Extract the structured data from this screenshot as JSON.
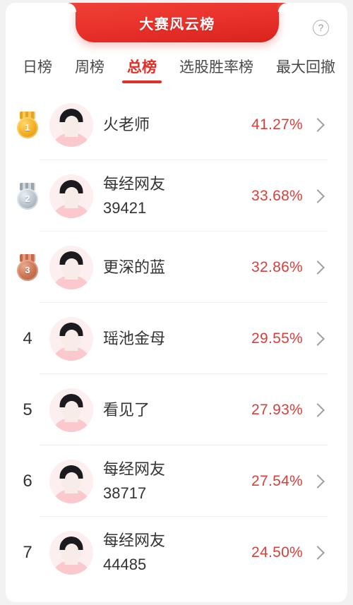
{
  "header": {
    "banner_title": "大赛风云榜",
    "help_label": "?",
    "help_icon": "question-mark-circle-icon"
  },
  "tabs": [
    {
      "label": "日榜",
      "active": false
    },
    {
      "label": "周榜",
      "active": false
    },
    {
      "label": "总榜",
      "active": true
    },
    {
      "label": "选股胜率榜",
      "active": false
    },
    {
      "label": "最大回撤",
      "active": false
    }
  ],
  "colors": {
    "brand_red": "#e8302a",
    "accent_red": "#e03027",
    "value_red": "#d6413b",
    "text_dark": "#333333",
    "divider": "#f0f0f0",
    "avatar_bg": "#fdeff0"
  },
  "leaderboard": [
    {
      "rank": "1",
      "medal": "gold",
      "name_line1": "火老师",
      "name_line2": "",
      "percent": "41.27%",
      "chevron": "chevron-right-icon"
    },
    {
      "rank": "2",
      "medal": "silver",
      "name_line1": "每经网友",
      "name_line2": "39421",
      "percent": "33.68%",
      "chevron": "chevron-right-icon"
    },
    {
      "rank": "3",
      "medal": "bronze",
      "name_line1": "更深的蓝",
      "name_line2": "",
      "percent": "32.86%",
      "chevron": "chevron-right-icon"
    },
    {
      "rank": "4",
      "medal": "",
      "name_line1": "瑶池金母",
      "name_line2": "",
      "percent": "29.55%",
      "chevron": "chevron-right-icon"
    },
    {
      "rank": "5",
      "medal": "",
      "name_line1": "看见了",
      "name_line2": "",
      "percent": "27.93%",
      "chevron": "chevron-right-icon"
    },
    {
      "rank": "6",
      "medal": "",
      "name_line1": "每经网友",
      "name_line2": "38717",
      "percent": "27.54%",
      "chevron": "chevron-right-icon"
    },
    {
      "rank": "7",
      "medal": "",
      "name_line1": "每经网友",
      "name_line2": "44485",
      "percent": "24.50%",
      "chevron": "chevron-right-icon"
    }
  ]
}
